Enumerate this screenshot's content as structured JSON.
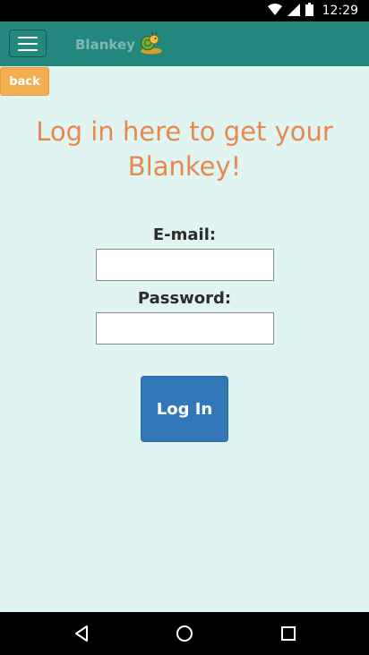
{
  "status_bar": {
    "time": "12:29",
    "icons": [
      "wifi-icon",
      "signal-icon",
      "battery-icon"
    ]
  },
  "app_bar": {
    "brand": "Blankey",
    "background_color": "#23877d"
  },
  "back_label": "back",
  "title": "Log in here to get your Blankey!",
  "form": {
    "email_label": "E-mail:",
    "email_value": "",
    "password_label": "Password:",
    "password_value": "",
    "submit_label": "Log In"
  },
  "nav_bar": {
    "icons": [
      "back-triangle-icon",
      "home-circle-icon",
      "recents-square-icon"
    ]
  },
  "colors": {
    "background": "#e0f5f2",
    "title": "#e8884d",
    "back_button": "#f2ae50",
    "login_button": "#3277b8"
  }
}
